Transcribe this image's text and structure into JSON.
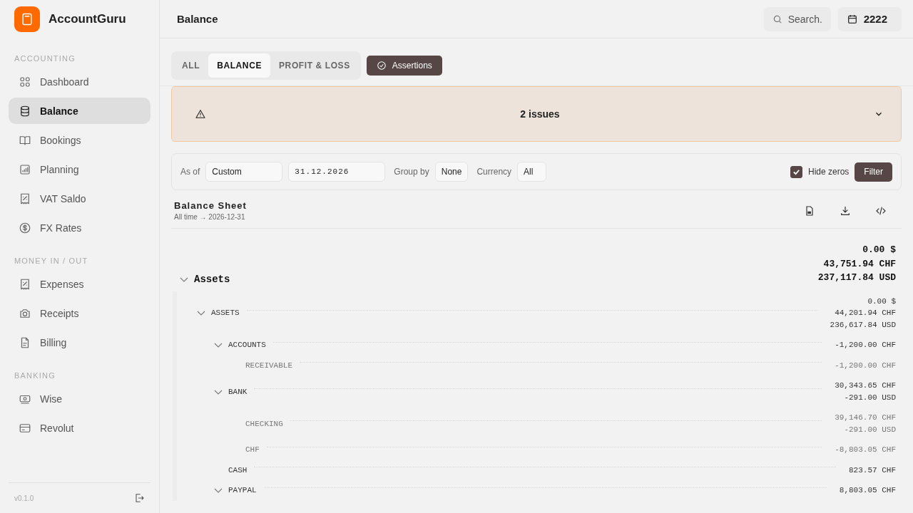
{
  "app": {
    "name": "AccountGuru"
  },
  "sidebar": {
    "sections": [
      {
        "title": "ACCOUNTING",
        "items": [
          {
            "label": "Dashboard",
            "selected": false
          },
          {
            "label": "Balance",
            "selected": true
          },
          {
            "label": "Bookings",
            "selected": false
          },
          {
            "label": "Planning",
            "selected": false
          },
          {
            "label": "VAT Saldo",
            "selected": false
          },
          {
            "label": "FX Rates",
            "selected": false
          }
        ]
      },
      {
        "title": "MONEY IN / OUT",
        "items": [
          {
            "label": "Expenses",
            "selected": false
          },
          {
            "label": "Receipts",
            "selected": false
          },
          {
            "label": "Billing",
            "selected": false
          }
        ]
      },
      {
        "title": "BANKING",
        "items": [
          {
            "label": "Wise",
            "selected": false
          },
          {
            "label": "Revolut",
            "selected": false
          }
        ]
      }
    ],
    "version": "v0.1.0"
  },
  "header": {
    "title": "Balance",
    "search": {
      "placeholder": "Search."
    },
    "year": "2222"
  },
  "tabs": [
    {
      "label": "ALL",
      "selected": false
    },
    {
      "label": "BALANCE",
      "selected": true
    },
    {
      "label": "PROFIT & LOSS",
      "selected": false
    }
  ],
  "assertions_button": "Assertions",
  "issues_banner": {
    "text": "2 issues",
    "expanded": false
  },
  "filters": {
    "as_of_label": "As of",
    "as_of": "Custom",
    "date": "31.12.2026",
    "group_by_label": "Group by",
    "group_by": "None",
    "currency_label": "Currency",
    "currency": "All",
    "hide_zeros": {
      "label": "Hide zeros",
      "checked": true
    },
    "filter_button": "Filter"
  },
  "report": {
    "title": "Balance Sheet",
    "subtitle": "All time → 2026-12-31",
    "tree": [
      {
        "label": "Assets",
        "expanded": true,
        "muted": false,
        "amounts": [
          "0.00 $",
          "43,751.94 CHF",
          "237,117.84 USD"
        ],
        "children": [
          {
            "label": "ASSETS",
            "expanded": true,
            "muted": false,
            "amounts": [
              "0.00 $",
              "44,201.94 CHF",
              "236,617.84 USD"
            ],
            "children": [
              {
                "label": "ACCOUNTS",
                "expanded": true,
                "muted": false,
                "amounts": [
                  "-1,200.00 CHF"
                ],
                "children": [
                  {
                    "label": "RECEIVABLE",
                    "muted": true,
                    "amounts": [
                      "-1,200.00 CHF"
                    ]
                  }
                ]
              },
              {
                "label": "BANK",
                "expanded": true,
                "muted": false,
                "amounts": [
                  "30,343.65 CHF",
                  "-291.00 USD"
                ],
                "children": [
                  {
                    "label": "CHECKING",
                    "muted": true,
                    "amounts": [
                      "39,146.70 CHF",
                      "-291.00 USD"
                    ]
                  },
                  {
                    "label": "CHF",
                    "muted": true,
                    "amounts": [
                      "-8,803.05 CHF"
                    ]
                  }
                ]
              },
              {
                "label": "CASH",
                "muted": false,
                "amounts": [
                  "823.57 CHF"
                ]
              },
              {
                "label": "PAYPAL",
                "expanded": true,
                "muted": false,
                "amounts": [
                  "8,803.05 CHF"
                ]
              }
            ]
          }
        ]
      }
    ]
  }
}
